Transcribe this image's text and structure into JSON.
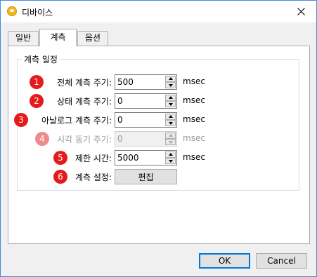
{
  "window": {
    "title": "디바이스",
    "close_icon": "close-icon",
    "accent": "#3b8edb"
  },
  "tabs": [
    {
      "label": "일반",
      "active": false
    },
    {
      "label": "계측",
      "active": true
    },
    {
      "label": "옵션",
      "active": false
    }
  ],
  "group": {
    "title": "계측 일정",
    "rows": [
      {
        "badge": "1",
        "label": "전체 계측 주기:",
        "value": "500",
        "unit": "msec",
        "enabled": true
      },
      {
        "badge": "2",
        "label": "상태 계측 주기:",
        "value": "0",
        "unit": "msec",
        "enabled": true
      },
      {
        "badge": "3",
        "label": "아날로그 계측 주기:",
        "value": "0",
        "unit": "msec",
        "enabled": true
      },
      {
        "badge": "4",
        "label": "시각 동기 주기:",
        "value": "0",
        "unit": "msec",
        "enabled": false
      },
      {
        "badge": "5",
        "label": "제한 시간:",
        "value": "5000",
        "unit": "msec",
        "enabled": true
      }
    ],
    "settings": {
      "badge": "6",
      "label": "계측 설정:",
      "button": "편집"
    }
  },
  "footer": {
    "ok": "OK",
    "cancel": "Cancel"
  },
  "colors": {
    "badge": "#e51a1a",
    "badge_disabled": "#f08b8b"
  }
}
